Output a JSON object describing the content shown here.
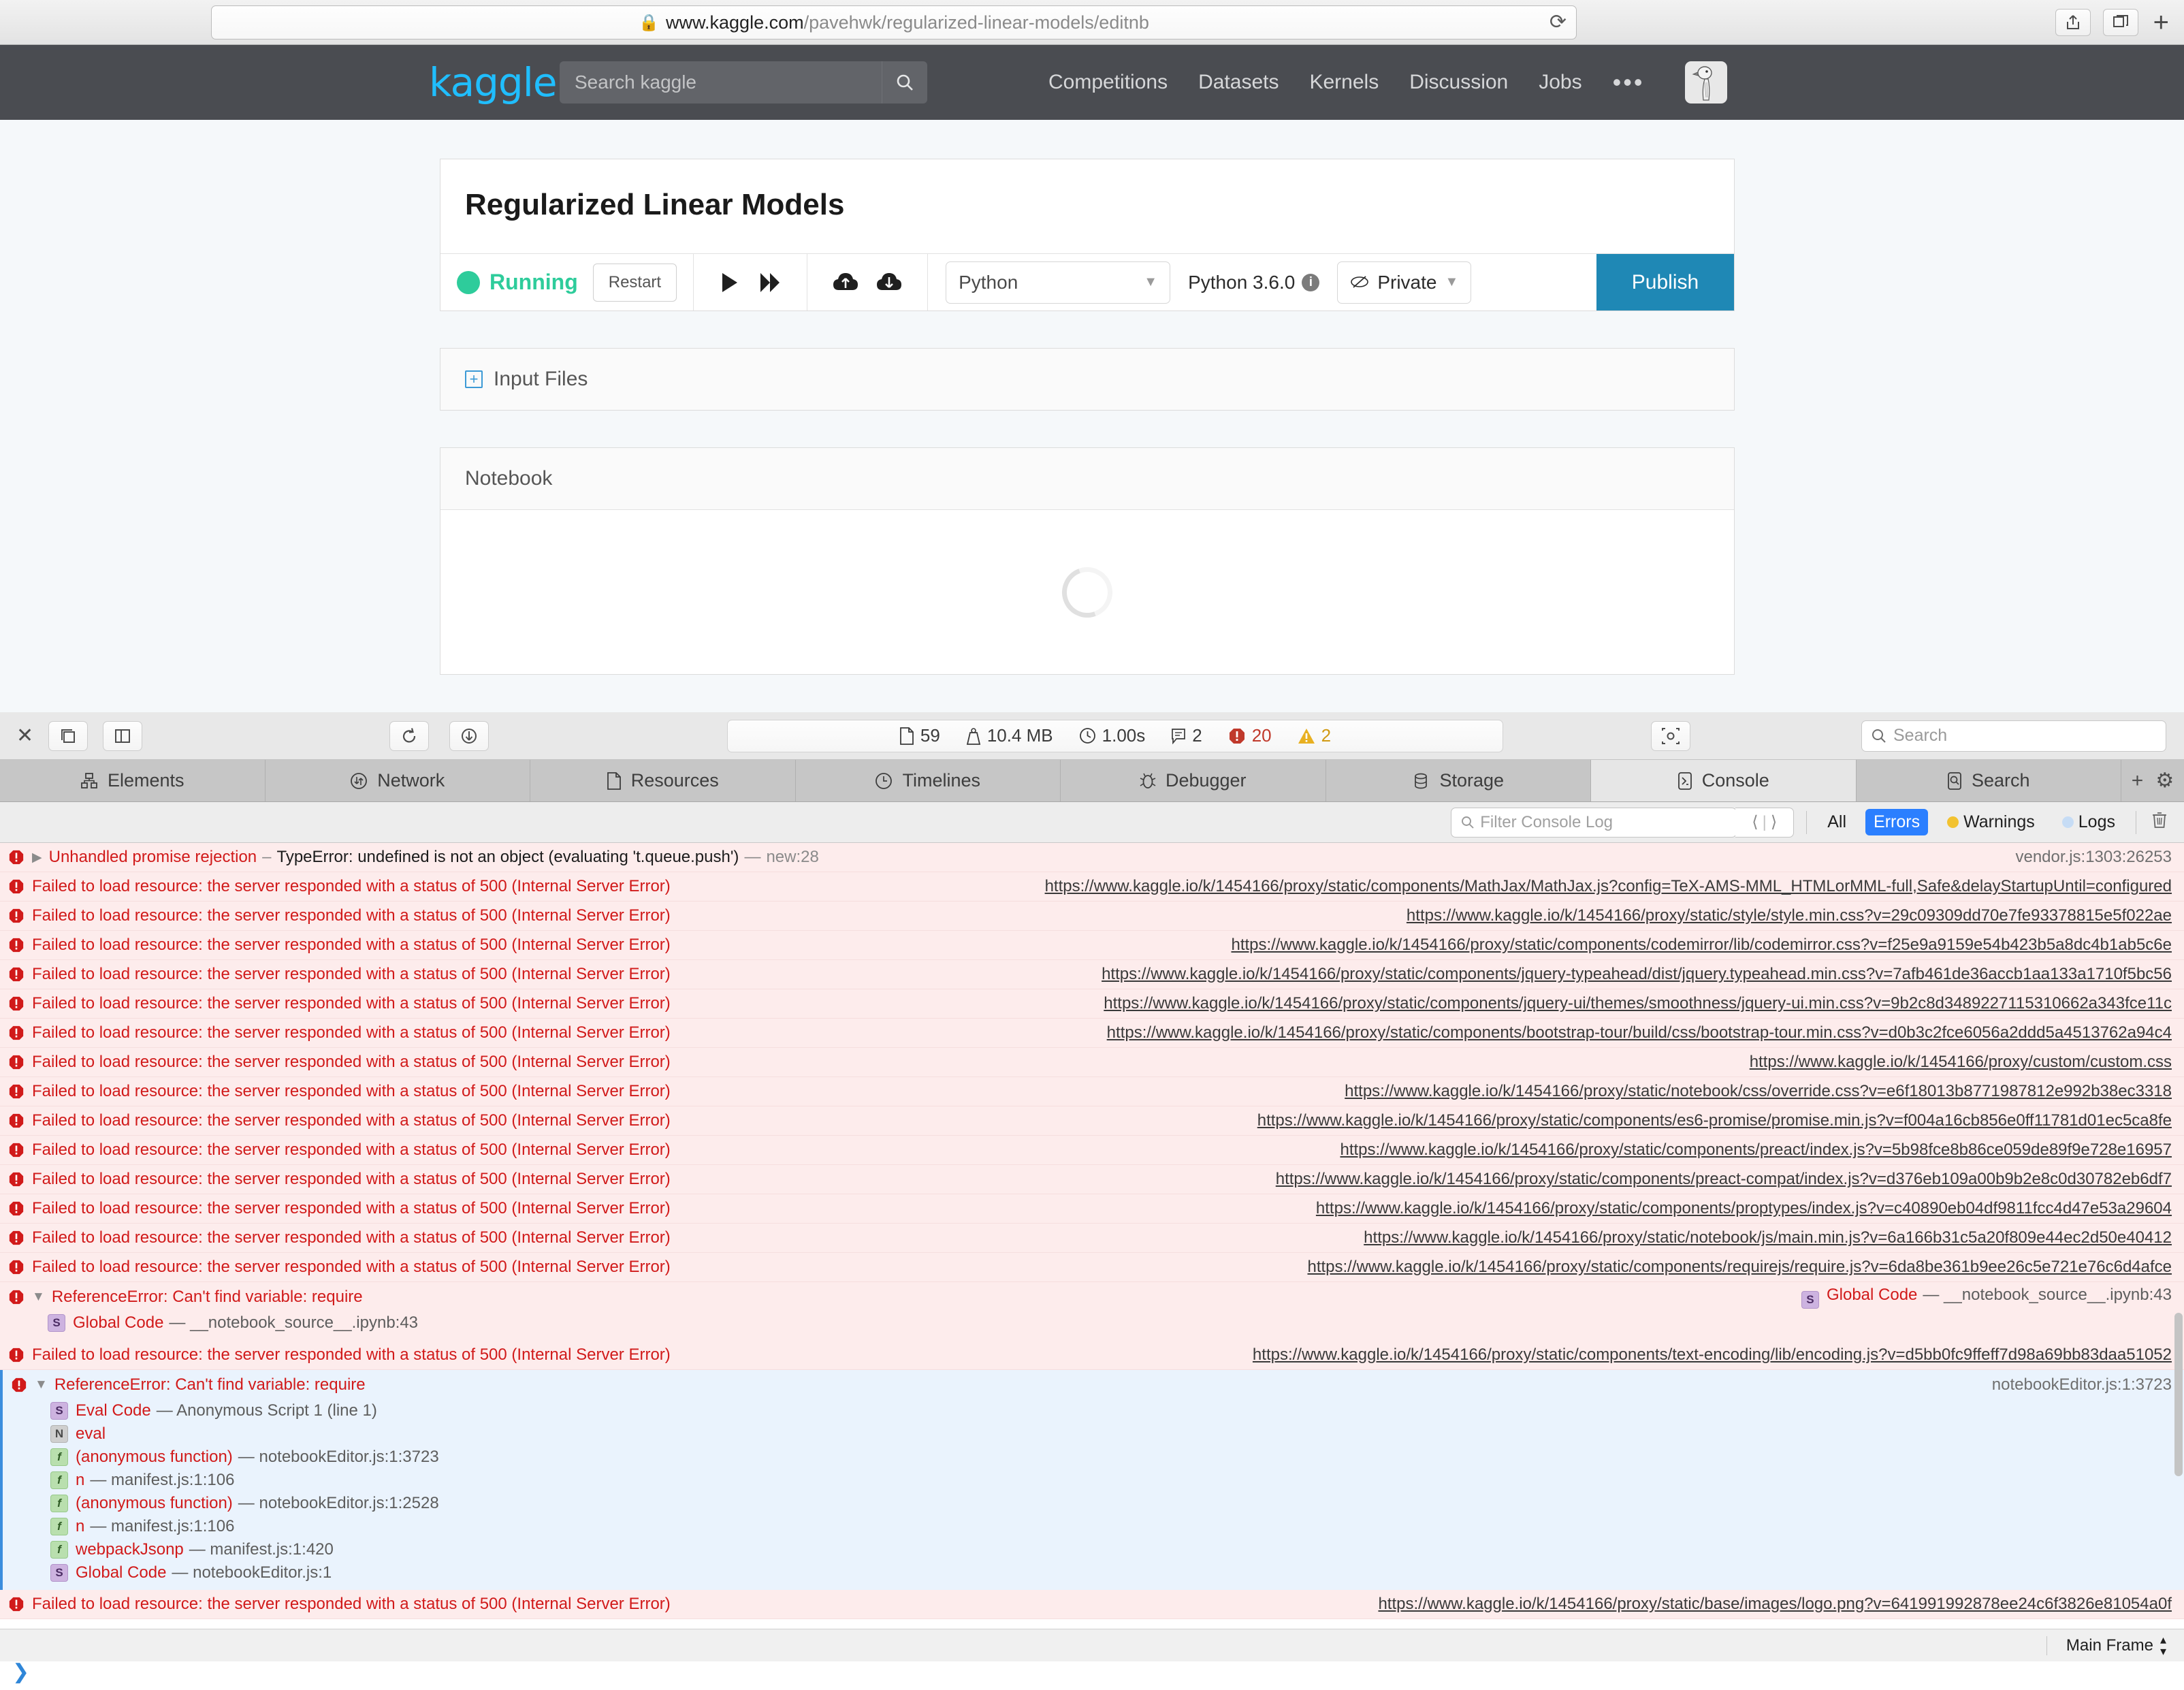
{
  "browser": {
    "url_host": "www.kaggle.com",
    "url_path": "/pavehwk/regularized-linear-models/editnb",
    "lock_icon": "lock-icon",
    "reload_icon": "reload-icon",
    "share_icon": "share-icon",
    "tabs_icon": "tabs-icon",
    "newtab_icon": "new-tab-icon"
  },
  "kaggle_header": {
    "logo": "kaggle",
    "search_placeholder": "Search kaggle",
    "search_icon": "search-icon",
    "nav": [
      "Competitions",
      "Datasets",
      "Kernels",
      "Discussion",
      "Jobs"
    ],
    "overflow": "•••",
    "avatar": "user-avatar"
  },
  "notebook": {
    "title": "Regularized Linear Models",
    "status": "Running",
    "restart_label": "Restart",
    "run_icon": "play-icon",
    "run_all_icon": "fast-forward-icon",
    "upload_icon": "cloud-upload-icon",
    "download_icon": "cloud-download-icon",
    "language": "Python",
    "version": "Python 3.6.0",
    "info_icon": "info-icon",
    "privacy": "Private",
    "privacy_icon": "eye-slash-icon",
    "publish_label": "Publish",
    "input_files_label": "Input Files",
    "input_files_expand_icon": "plus-square-icon",
    "notebook_panel_label": "Notebook",
    "loading_icon": "spinner-icon"
  },
  "inspector": {
    "close_icon": "close-icon",
    "dock_icon": "dock-window-icon",
    "split_icon": "split-panel-icon",
    "reload_icon": "reload-icon",
    "download_icon": "download-icon",
    "node_inspect_icon": "crosshair-icon",
    "search_placeholder": "Search",
    "search_icon": "search-icon",
    "stats": [
      {
        "icon": "document-icon",
        "value": "59"
      },
      {
        "icon": "weight-icon",
        "value": "10.4 MB"
      },
      {
        "icon": "clock-icon",
        "value": "1.00s"
      },
      {
        "icon": "message-icon",
        "value": "2"
      },
      {
        "icon": "error-icon",
        "value": "20"
      },
      {
        "icon": "warning-icon",
        "value": "2"
      }
    ],
    "tabs": [
      {
        "label": "Elements",
        "icon": "elements-icon",
        "active": false
      },
      {
        "label": "Network",
        "icon": "network-icon",
        "active": false
      },
      {
        "label": "Resources",
        "icon": "resources-icon",
        "active": false
      },
      {
        "label": "Timelines",
        "icon": "timelines-icon",
        "active": false
      },
      {
        "label": "Debugger",
        "icon": "debugger-icon",
        "active": false
      },
      {
        "label": "Storage",
        "icon": "storage-icon",
        "active": false
      },
      {
        "label": "Console",
        "icon": "console-icon",
        "active": true
      },
      {
        "label": "Search",
        "icon": "search-icon",
        "active": false
      }
    ],
    "tab_add_icon": "plus-icon",
    "tab_settings_icon": "gear-icon",
    "console_bar": {
      "filter_placeholder": "Filter Console Log",
      "filter_icon": "search-icon",
      "prev_icon": "chevron-left-icon",
      "next_icon": "chevron-right-icon",
      "scopes": [
        {
          "label": "All",
          "active": false,
          "dot": ""
        },
        {
          "label": "Errors",
          "active": true,
          "dot": ""
        },
        {
          "label": "Warnings",
          "active": false,
          "dot": "yellow"
        },
        {
          "label": "Logs",
          "active": false,
          "dot": "blue"
        }
      ],
      "clear_icon": "trash-icon"
    },
    "prompt_icon": "chevron-right-prompt-icon",
    "status_frame": "Main Frame",
    "status_frame_icon": "updown-chevron-icon"
  },
  "console_rows": [
    {
      "kind": "expandable",
      "title": "Unhandled promise rejection",
      "dash1": "–",
      "detail": "TypeError: undefined is not an object (evaluating 't.queue.push')",
      "dash2": "—",
      "detail2": "new:28",
      "right": "vendor.js:1303:26253",
      "right_link": false
    },
    {
      "kind": "resource",
      "message": "Failed to load resource: the server responded with a status of 500 (Internal Server Error)",
      "right": "https://www.kaggle.io/k/1454166/proxy/static/components/MathJax/MathJax.js?config=TeX-AMS-MML_HTMLorMML-full,Safe&delayStartupUntil=configured"
    },
    {
      "kind": "resource",
      "message": "Failed to load resource: the server responded with a status of 500 (Internal Server Error)",
      "right": "https://www.kaggle.io/k/1454166/proxy/static/style/style.min.css?v=29c09309dd70e7fe93378815e5f022ae"
    },
    {
      "kind": "resource",
      "message": "Failed to load resource: the server responded with a status of 500 (Internal Server Error)",
      "right": "https://www.kaggle.io/k/1454166/proxy/static/components/codemirror/lib/codemirror.css?v=f25e9a9159e54b423b5a8dc4b1ab5c6e"
    },
    {
      "kind": "resource",
      "message": "Failed to load resource: the server responded with a status of 500 (Internal Server Error)",
      "right": "https://www.kaggle.io/k/1454166/proxy/static/components/jquery-typeahead/dist/jquery.typeahead.min.css?v=7afb461de36accb1aa133a1710f5bc56"
    },
    {
      "kind": "resource",
      "message": "Failed to load resource: the server responded with a status of 500 (Internal Server Error)",
      "right": "https://www.kaggle.io/k/1454166/proxy/static/components/jquery-ui/themes/smoothness/jquery-ui.min.css?v=9b2c8d3489227115310662a343fce11c"
    },
    {
      "kind": "resource",
      "message": "Failed to load resource: the server responded with a status of 500 (Internal Server Error)",
      "right": "https://www.kaggle.io/k/1454166/proxy/static/components/bootstrap-tour/build/css/bootstrap-tour.min.css?v=d0b3c2fce6056a2ddd5a4513762a94c4"
    },
    {
      "kind": "resource",
      "message": "Failed to load resource: the server responded with a status of 500 (Internal Server Error)",
      "right": "https://www.kaggle.io/k/1454166/proxy/custom/custom.css"
    },
    {
      "kind": "resource",
      "message": "Failed to load resource: the server responded with a status of 500 (Internal Server Error)",
      "right": "https://www.kaggle.io/k/1454166/proxy/static/notebook/css/override.css?v=e6f18013b8771987812e992b38ec3318"
    },
    {
      "kind": "resource",
      "message": "Failed to load resource: the server responded with a status of 500 (Internal Server Error)",
      "right": "https://www.kaggle.io/k/1454166/proxy/static/components/es6-promise/promise.min.js?v=f004a16cb856e0ff11781d01ec5ca8fe"
    },
    {
      "kind": "resource",
      "message": "Failed to load resource: the server responded with a status of 500 (Internal Server Error)",
      "right": "https://www.kaggle.io/k/1454166/proxy/static/components/preact/index.js?v=5b98fce8b86ce059de89f9e728e16957"
    },
    {
      "kind": "resource",
      "message": "Failed to load resource: the server responded with a status of 500 (Internal Server Error)",
      "right": "https://www.kaggle.io/k/1454166/proxy/static/components/preact-compat/index.js?v=d376eb109a00b9b2e8c0d30782eb6df7"
    },
    {
      "kind": "resource",
      "message": "Failed to load resource: the server responded with a status of 500 (Internal Server Error)",
      "right": "https://www.kaggle.io/k/1454166/proxy/static/components/proptypes/index.js?v=c40890eb04df9811fcc4d47e53a29604"
    },
    {
      "kind": "resource",
      "message": "Failed to load resource: the server responded with a status of 500 (Internal Server Error)",
      "right": "https://www.kaggle.io/k/1454166/proxy/static/notebook/js/main.min.js?v=6a166b31c5a20f809e44ec2d50e40412"
    },
    {
      "kind": "resource",
      "message": "Failed to load resource: the server responded with a status of 500 (Internal Server Error)",
      "right": "https://www.kaggle.io/k/1454166/proxy/static/components/requirejs/require.js?v=6da8be361b9ee26c5e721e76c6d4afce"
    }
  ],
  "group_one": {
    "title": "ReferenceError: Can't find variable: require",
    "right_badge": "S",
    "right_name": "Global Code",
    "right_dash": "—",
    "right_loc": "__notebook_source__.ipynb:43",
    "frames": [
      {
        "badge": "S",
        "name": "Global Code",
        "dash": "—",
        "loc": "__notebook_source__.ipynb:43"
      }
    ]
  },
  "mid_resource_row": {
    "message": "Failed to load resource: the server responded with a status of 500 (Internal Server Error)",
    "right": "https://www.kaggle.io/k/1454166/proxy/static/components/text-encoding/lib/encoding.js?v=d5bb0fc9ffeff7d98a69bb83daa51052"
  },
  "group_two": {
    "title": "ReferenceError: Can't find variable: require",
    "right_loc": "notebookEditor.js:1:3723",
    "frames": [
      {
        "badge": "S",
        "name": "Eval Code",
        "dash": "—",
        "loc": "Anonymous Script 1 (line 1)"
      },
      {
        "badge": "N",
        "name": "eval",
        "dash": "",
        "loc": ""
      },
      {
        "badge": "f",
        "name": "(anonymous function)",
        "dash": "—",
        "loc": "notebookEditor.js:1:3723"
      },
      {
        "badge": "f",
        "name": "n",
        "dash": "—",
        "loc": "manifest.js:1:106"
      },
      {
        "badge": "f",
        "name": "(anonymous function)",
        "dash": "—",
        "loc": "notebookEditor.js:1:2528"
      },
      {
        "badge": "f",
        "name": "n",
        "dash": "—",
        "loc": "manifest.js:1:106"
      },
      {
        "badge": "f",
        "name": "webpackJsonp",
        "dash": "—",
        "loc": "manifest.js:1:420"
      },
      {
        "badge": "S",
        "name": "Global Code",
        "dash": "—",
        "loc": "notebookEditor.js:1"
      }
    ]
  },
  "last_row": {
    "message": "Failed to load resource: the server responded with a status of 500 (Internal Server Error)",
    "right": "https://www.kaggle.io/k/1454166/proxy/static/base/images/logo.png?v=641991992878ee24c6f3826e81054a0f"
  }
}
